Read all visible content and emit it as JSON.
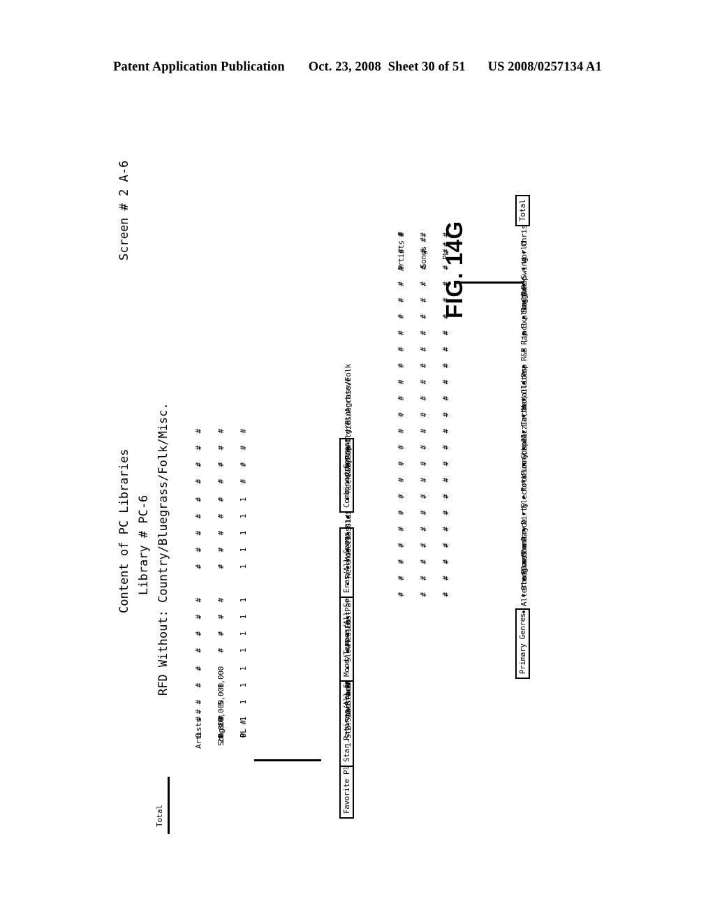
{
  "page_header": {
    "publication": "Patent Application Publication",
    "date": "Oct. 23, 2008",
    "sheet": "Sheet 30 of 51",
    "patent_number": "US 2008/0257134 A1"
  },
  "figure": {
    "label": "FIG. 14G",
    "title": "Content of PC Libraries",
    "library": "Library # PC-6",
    "rfd_without": "RFD Without:  Country/Bluegrass/Folk/Misc.",
    "screen": "Screen # 2 A-6"
  },
  "left_panel": {
    "section_header": "Total",
    "columns": [
      "PL #",
      "Songs #",
      "Artists #"
    ],
    "groups": [
      {
        "name": "favorite-play-lists",
        "heading": "Favorite Play Lists",
        "boxed": true,
        "rows": []
      },
      {
        "name": "star-ratings",
        "heading": "Star Ratings/All Songs",
        "boxed": true,
        "rows": [
          {
            "label": "1-Star and Above",
            "bullet": false,
            "pl": "0",
            "songs": "0",
            "artists": "0"
          },
          {
            "label": "2-Stars and Above",
            "bullet": false,
            "pl": "1",
            "songs": "20,000",
            "artists": "#"
          },
          {
            "label": "3-Stars and Above",
            "bullet": false,
            "pl": "1",
            "songs": "10,000",
            "artists": "#"
          },
          {
            "label": "4-Stars and Above",
            "bullet": false,
            "pl": "1",
            "songs": "5,000",
            "artists": "#"
          },
          {
            "label": "5-Stars and Above",
            "bullet": false,
            "pl": "1",
            "songs": "1,000",
            "artists": "#"
          }
        ]
      },
      {
        "name": "mood-tempos",
        "heading": "Mood/Tempos/All Songs",
        "boxed": true,
        "rows": [
          {
            "label": "Slow",
            "bullet": true,
            "pl": "1",
            "songs": "#",
            "artists": "#"
          },
          {
            "label": "Medium",
            "bullet": true,
            "pl": "1",
            "songs": "#",
            "artists": "#"
          },
          {
            "label": "Fast",
            "bullet": true,
            "pl": "1",
            "songs": "#",
            "artists": "#"
          },
          {
            "label": "Party (Danceable)",
            "bullet": true,
            "pl": "1",
            "songs": "#",
            "artists": "#"
          }
        ]
      },
      {
        "name": "eras",
        "heading": "Eras/All Songs",
        "boxed": true,
        "rows": [
          {
            "label": "Recent",
            "bullet": true,
            "pl": "1",
            "songs": "#",
            "artists": "#"
          },
          {
            "label": "Modern",
            "bullet": true,
            "pl": "1",
            "songs": "#",
            "artists": "#"
          },
          {
            "label": "Classics",
            "bullet": true,
            "pl": "1",
            "songs": "#",
            "artists": "#"
          },
          {
            "label": "Oldies",
            "bullet": true,
            "pl": "1",
            "songs": "#",
            "artists": "#"
          },
          {
            "label": "Archive",
            "bullet": true,
            "pl": "1",
            "songs": "#",
            "artists": "#"
          }
        ]
      },
      {
        "name": "combined-genres",
        "heading": "Combined Genres",
        "boxed": true,
        "rows": [
          {
            "label": "Rock/Pop",
            "bullet": true,
            "pl": "#",
            "songs": "#",
            "artists": "#"
          },
          {
            "label": "R&B/Rap",
            "bullet": true,
            "pl": "#",
            "songs": "#",
            "artists": "#"
          },
          {
            "label": "Country/Bluegrass/Folk",
            "bullet": true,
            "pl": "#",
            "songs": "#",
            "artists": "#"
          },
          {
            "label": "Oldies/Archieve",
            "bullet": true,
            "pl": "#",
            "songs": "#",
            "artists": "#"
          }
        ]
      }
    ]
  },
  "right_panel": {
    "columns": [
      "PL #",
      "Songs #",
      "Artists #"
    ],
    "heading": "Primary Genres",
    "total_label": "Total",
    "rows": [
      {
        "label": "Alternative/Punk",
        "pl": "#",
        "songs": "#",
        "artists": "#"
      },
      {
        "label": "Bluegrass",
        "pl": "#",
        "songs": "#",
        "artists": "#"
      },
      {
        "label": "Blues",
        "pl": "#",
        "songs": "#",
        "artists": "#"
      },
      {
        "label": "Country",
        "pl": "#",
        "songs": "#",
        "artists": "#"
      },
      {
        "label": "Dance",
        "pl": "#",
        "songs": "#",
        "artists": "#"
      },
      {
        "label": "Dirty",
        "pl": "#",
        "songs": "#",
        "artists": "#"
      },
      {
        "label": "Electronica (incl. Techno)",
        "pl": "#",
        "songs": "#",
        "artists": "#"
      },
      {
        "label": "Folk",
        "pl": "#",
        "songs": "#",
        "artists": "#"
      },
      {
        "label": "Funny",
        "pl": "#",
        "songs": "#",
        "artists": "#"
      },
      {
        "label": "Gospel",
        "pl": "#",
        "songs": "#",
        "artists": "#"
      },
      {
        "label": "Jazz",
        "pl": "#",
        "songs": "#",
        "artists": "#"
      },
      {
        "label": "Latin",
        "pl": "#",
        "songs": "#",
        "artists": "#"
      },
      {
        "label": "Metallica",
        "pl": "#",
        "songs": "#",
        "artists": "#"
      },
      {
        "label": "Oldies",
        "pl": "#",
        "songs": "#",
        "artists": "#"
      },
      {
        "label": "Pop",
        "pl": "#",
        "songs": "#",
        "artists": "#"
      },
      {
        "label": "R&B (incl. Soul)",
        "pl": "#",
        "songs": "#",
        "artists": "#"
      },
      {
        "label": "Rap",
        "pl": "#",
        "songs": "#",
        "artists": "#"
      },
      {
        "label": "Explicit Rap",
        "pl": "#",
        "songs": "#",
        "artists": "#"
      },
      {
        "label": "Reggae",
        "pl": "#",
        "songs": "#",
        "artists": "#"
      },
      {
        "label": "Rock",
        "pl": "#",
        "songs": "#",
        "artists": "#"
      },
      {
        "label": "Swing",
        "pl": "#",
        "songs": "#",
        "artists": "#"
      },
      {
        "label": "World",
        "pl": "#",
        "songs": "#",
        "artists": "#"
      },
      {
        "label": "Christmas",
        "pl": "#",
        "songs": "#",
        "artists": "#"
      }
    ]
  }
}
